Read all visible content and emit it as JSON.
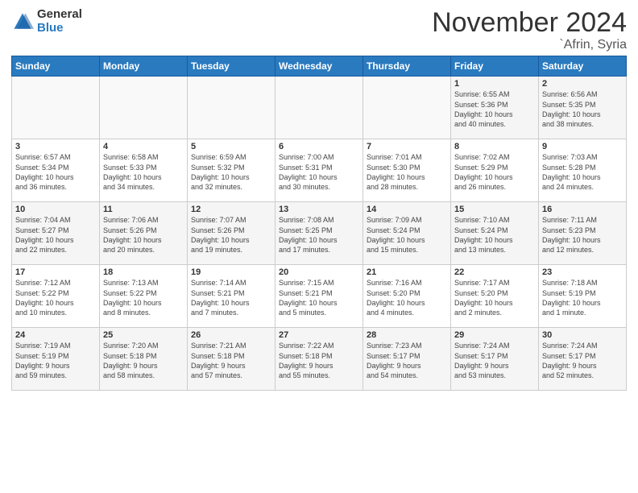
{
  "logo": {
    "general": "General",
    "blue": "Blue"
  },
  "header": {
    "month": "November 2024",
    "location": "`Afrin, Syria"
  },
  "weekdays": [
    "Sunday",
    "Monday",
    "Tuesday",
    "Wednesday",
    "Thursday",
    "Friday",
    "Saturday"
  ],
  "weeks": [
    [
      {
        "day": "",
        "info": ""
      },
      {
        "day": "",
        "info": ""
      },
      {
        "day": "",
        "info": ""
      },
      {
        "day": "",
        "info": ""
      },
      {
        "day": "",
        "info": ""
      },
      {
        "day": "1",
        "info": "Sunrise: 6:55 AM\nSunset: 5:36 PM\nDaylight: 10 hours\nand 40 minutes."
      },
      {
        "day": "2",
        "info": "Sunrise: 6:56 AM\nSunset: 5:35 PM\nDaylight: 10 hours\nand 38 minutes."
      }
    ],
    [
      {
        "day": "3",
        "info": "Sunrise: 6:57 AM\nSunset: 5:34 PM\nDaylight: 10 hours\nand 36 minutes."
      },
      {
        "day": "4",
        "info": "Sunrise: 6:58 AM\nSunset: 5:33 PM\nDaylight: 10 hours\nand 34 minutes."
      },
      {
        "day": "5",
        "info": "Sunrise: 6:59 AM\nSunset: 5:32 PM\nDaylight: 10 hours\nand 32 minutes."
      },
      {
        "day": "6",
        "info": "Sunrise: 7:00 AM\nSunset: 5:31 PM\nDaylight: 10 hours\nand 30 minutes."
      },
      {
        "day": "7",
        "info": "Sunrise: 7:01 AM\nSunset: 5:30 PM\nDaylight: 10 hours\nand 28 minutes."
      },
      {
        "day": "8",
        "info": "Sunrise: 7:02 AM\nSunset: 5:29 PM\nDaylight: 10 hours\nand 26 minutes."
      },
      {
        "day": "9",
        "info": "Sunrise: 7:03 AM\nSunset: 5:28 PM\nDaylight: 10 hours\nand 24 minutes."
      }
    ],
    [
      {
        "day": "10",
        "info": "Sunrise: 7:04 AM\nSunset: 5:27 PM\nDaylight: 10 hours\nand 22 minutes."
      },
      {
        "day": "11",
        "info": "Sunrise: 7:06 AM\nSunset: 5:26 PM\nDaylight: 10 hours\nand 20 minutes."
      },
      {
        "day": "12",
        "info": "Sunrise: 7:07 AM\nSunset: 5:26 PM\nDaylight: 10 hours\nand 19 minutes."
      },
      {
        "day": "13",
        "info": "Sunrise: 7:08 AM\nSunset: 5:25 PM\nDaylight: 10 hours\nand 17 minutes."
      },
      {
        "day": "14",
        "info": "Sunrise: 7:09 AM\nSunset: 5:24 PM\nDaylight: 10 hours\nand 15 minutes."
      },
      {
        "day": "15",
        "info": "Sunrise: 7:10 AM\nSunset: 5:24 PM\nDaylight: 10 hours\nand 13 minutes."
      },
      {
        "day": "16",
        "info": "Sunrise: 7:11 AM\nSunset: 5:23 PM\nDaylight: 10 hours\nand 12 minutes."
      }
    ],
    [
      {
        "day": "17",
        "info": "Sunrise: 7:12 AM\nSunset: 5:22 PM\nDaylight: 10 hours\nand 10 minutes."
      },
      {
        "day": "18",
        "info": "Sunrise: 7:13 AM\nSunset: 5:22 PM\nDaylight: 10 hours\nand 8 minutes."
      },
      {
        "day": "19",
        "info": "Sunrise: 7:14 AM\nSunset: 5:21 PM\nDaylight: 10 hours\nand 7 minutes."
      },
      {
        "day": "20",
        "info": "Sunrise: 7:15 AM\nSunset: 5:21 PM\nDaylight: 10 hours\nand 5 minutes."
      },
      {
        "day": "21",
        "info": "Sunrise: 7:16 AM\nSunset: 5:20 PM\nDaylight: 10 hours\nand 4 minutes."
      },
      {
        "day": "22",
        "info": "Sunrise: 7:17 AM\nSunset: 5:20 PM\nDaylight: 10 hours\nand 2 minutes."
      },
      {
        "day": "23",
        "info": "Sunrise: 7:18 AM\nSunset: 5:19 PM\nDaylight: 10 hours\nand 1 minute."
      }
    ],
    [
      {
        "day": "24",
        "info": "Sunrise: 7:19 AM\nSunset: 5:19 PM\nDaylight: 9 hours\nand 59 minutes."
      },
      {
        "day": "25",
        "info": "Sunrise: 7:20 AM\nSunset: 5:18 PM\nDaylight: 9 hours\nand 58 minutes."
      },
      {
        "day": "26",
        "info": "Sunrise: 7:21 AM\nSunset: 5:18 PM\nDaylight: 9 hours\nand 57 minutes."
      },
      {
        "day": "27",
        "info": "Sunrise: 7:22 AM\nSunset: 5:18 PM\nDaylight: 9 hours\nand 55 minutes."
      },
      {
        "day": "28",
        "info": "Sunrise: 7:23 AM\nSunset: 5:17 PM\nDaylight: 9 hours\nand 54 minutes."
      },
      {
        "day": "29",
        "info": "Sunrise: 7:24 AM\nSunset: 5:17 PM\nDaylight: 9 hours\nand 53 minutes."
      },
      {
        "day": "30",
        "info": "Sunrise: 7:24 AM\nSunset: 5:17 PM\nDaylight: 9 hours\nand 52 minutes."
      }
    ]
  ]
}
